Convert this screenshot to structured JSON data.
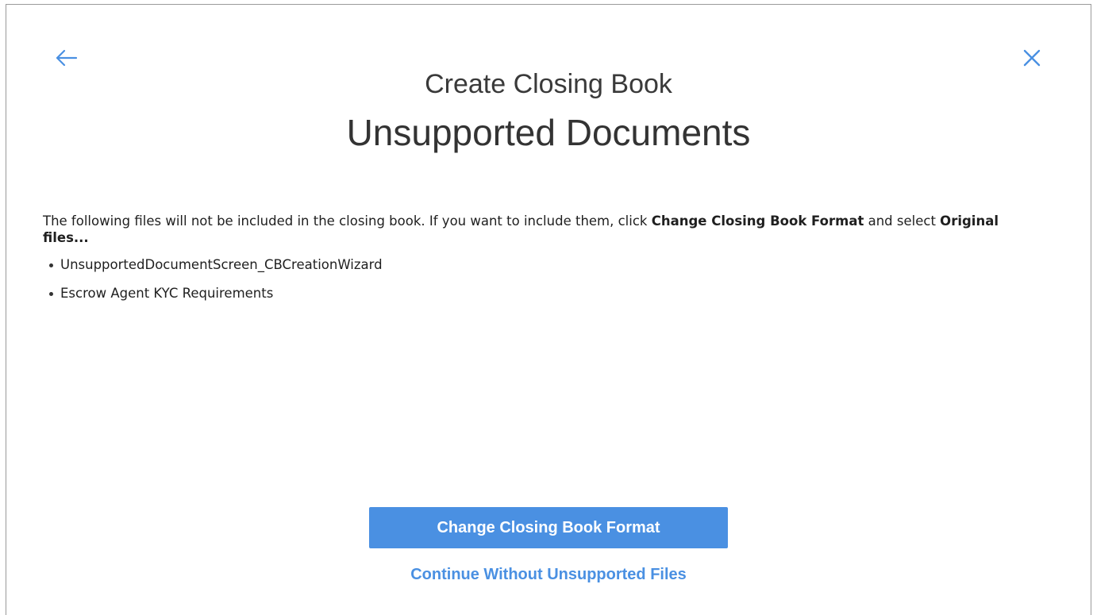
{
  "dialog": {
    "subtitle": "Create Closing Book",
    "title": "Unsupported Documents",
    "intro_part1": "The following files will not be included in the closing book. If you want to include them, click ",
    "intro_bold1": "Change Closing Book Format",
    "intro_part2": " and select ",
    "intro_bold2": "Original files...",
    "files": [
      "UnsupportedDocumentScreen_CBCreationWizard",
      "Escrow Agent KYC Requirements"
    ],
    "primary_button": "Change Closing Book Format",
    "secondary_link": "Continue Without Unsupported Files"
  },
  "icons": {
    "back": "arrow-left-icon",
    "close": "close-icon"
  },
  "colors": {
    "accent": "#4a90e2",
    "text": "#1f1f1f",
    "border": "#9a9a9a"
  }
}
